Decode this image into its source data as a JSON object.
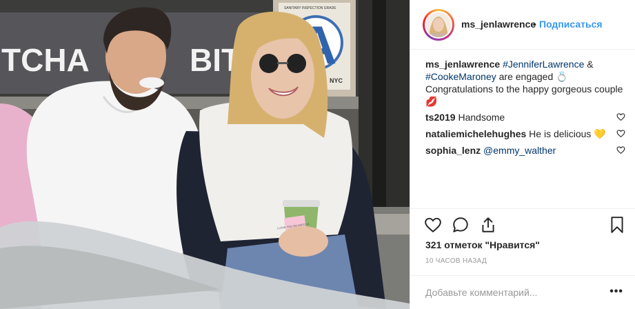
{
  "photo": {
    "sign_left": "TCHA",
    "sign_right": "BIT",
    "inspection_title": "SANITARY INSPECTION GRADE",
    "inspection_grade": "A",
    "inspection_nyc": "NYC",
    "cup_text": "I LOVE YOU SO MATCHA"
  },
  "header": {
    "username": "ms_jenlawrence",
    "separator": "•",
    "follow_label": "Подписаться"
  },
  "caption": {
    "username": "ms_jenlawrence",
    "tag1": "#JenniferLawrence",
    "amp": " & ",
    "tag2": "#CookeMaroney",
    "text1": " are engaged 💍",
    "text2": "Congratulations to the happy gorgeous couple 💋"
  },
  "comments": [
    {
      "username": "ts2019",
      "text": "Handsome",
      "mention": ""
    },
    {
      "username": "nataliemichelehughes",
      "text": "He is delicious 💛",
      "mention": ""
    },
    {
      "username": "sophia_lenz",
      "text": "",
      "mention": "@emmy_walther"
    }
  ],
  "likes": "321 отметок \"Нравится\"",
  "time_ago": "10 ЧАСОВ НАЗАД",
  "comment_input": {
    "placeholder": "Добавьте комментарий...",
    "value": ""
  },
  "more_label": "•••",
  "colors": {
    "link": "#003569",
    "follow": "#3897f0",
    "muted": "#999999",
    "text": "#262626"
  }
}
